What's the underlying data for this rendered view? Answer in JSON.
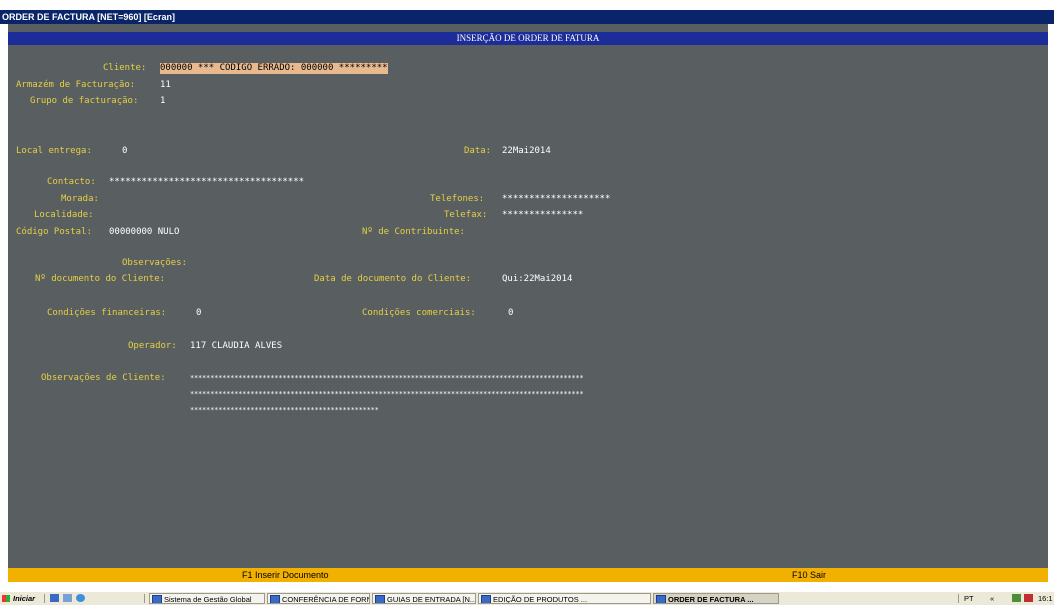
{
  "window_title": "ORDER DE FACTURA   [NET=960]   [Ecran]",
  "screen_header": "INSERÇÃO DE ORDER DE FATURA",
  "form": {
    "cliente_label": "Cliente:",
    "cliente_value": "000000 *** CODIGO ERRADO: 000000 *********",
    "armazem_label": "Armazém de Facturação:",
    "armazem_value": "11",
    "grupo_label": "Grupo de facturação:",
    "grupo_value": "1",
    "local_label": "Local entrega:",
    "local_value": "0",
    "data_label": "Data:",
    "data_value": "22Mai2014",
    "contacto_label": "Contacto:",
    "contacto_value": "************************************",
    "morada_label": "Morada:",
    "telefones_label": "Telefones:",
    "telefones_value": "********************",
    "localidade_label": "Localidade:",
    "telefax_label": "Telefax:",
    "telefax_value": "***************",
    "codpostal_label": "Código Postal:",
    "codpostal_value": "00000000 NULO",
    "contribuinte_label": "Nº de Contribuinte:",
    "observacoes_label": "Observações:",
    "ndoc_label": "Nº documento do Cliente:",
    "datadoc_label": "Data de documento do Cliente:",
    "datadoc_value": "Qui:22Mai2014",
    "condfin_label": "Condições financeiras:",
    "condfin_value": "0",
    "condcom_label": "Condições comerciais:",
    "condcom_value": "0",
    "operador_label": "Operador:",
    "operador_value": "117 CLAUDIA ALVES",
    "obscliente_label": "Observações de Cliente:",
    "obscliente_line1": "**************************************************************************************************",
    "obscliente_line2": "**************************************************************************************************",
    "obscliente_line3": "***********************************************"
  },
  "function_keys": {
    "f1": "F1  Inserir Documento",
    "f10": "F10 Sair"
  },
  "taskbar": {
    "start_label": "Iniciar",
    "tasks": [
      "Sistema de Gestão Global",
      "CONFERÊNCIA DE FORN...",
      "GUIAS DE ENTRADA   [N...",
      "EDIÇÃO DE PRODUTOS ...",
      "ORDER DE FACTURA   ..."
    ],
    "language": "PT",
    "tray_arrows": "«",
    "clock": "16:1"
  }
}
